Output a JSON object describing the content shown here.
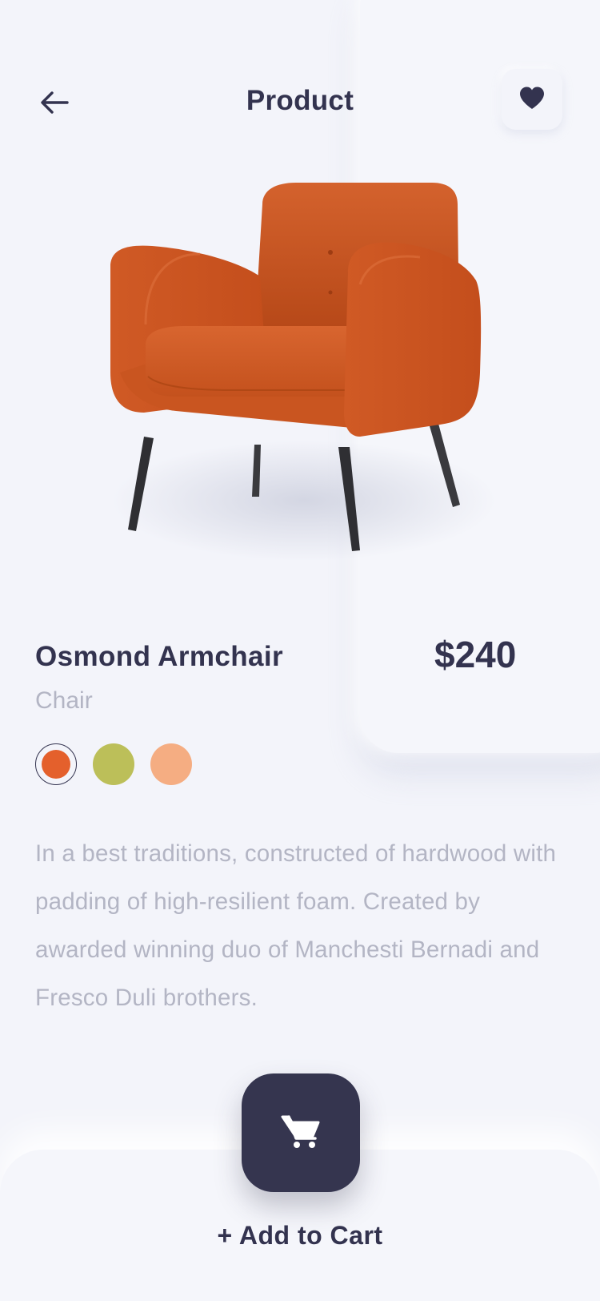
{
  "header": {
    "title": "Product",
    "back_icon": "arrow-left-icon",
    "favorite_icon": "heart-icon"
  },
  "product": {
    "name": "Osmond Armchair",
    "category": "Chair",
    "price": "$240",
    "image": "orange-armchair-image",
    "colors": [
      {
        "name": "orange",
        "hex": "#e4602c",
        "selected": true
      },
      {
        "name": "olive",
        "hex": "#bcbf59",
        "selected": false
      },
      {
        "name": "peach",
        "hex": "#f5ad82",
        "selected": false
      }
    ],
    "description": "In a best traditions, constructed of hardwood with padding of high-resilient foam. Created by awarded winning duo of Manchesti Bernadi and Fresco Duli brothers."
  },
  "cart": {
    "icon": "shopping-cart-icon",
    "label": "+ Add to Cart"
  },
  "theme": {
    "background": "#f3f4fa",
    "dark": "#35354f",
    "muted_text": "#b3b5c4"
  }
}
